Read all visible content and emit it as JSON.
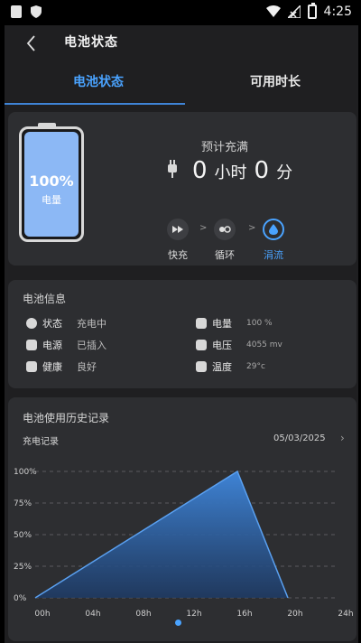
{
  "status_bar": {
    "time": "4:25"
  },
  "header": {
    "title": "电池状态",
    "back_icon": "back-chevron-icon"
  },
  "tabs": [
    {
      "label": "电池状态",
      "active": true
    },
    {
      "label": "可用时长",
      "active": false
    }
  ],
  "battery": {
    "percent_text": "100%",
    "label": "电量",
    "level": 1.0,
    "fill_color": "#8cb8f5"
  },
  "full_charge": {
    "title": "预计充满",
    "hours": "0",
    "hours_unit": "小时",
    "minutes": "0",
    "minutes_unit": "分"
  },
  "charge_modes": [
    {
      "label": "快充",
      "icon": "fast-forward-icon",
      "active": false
    },
    {
      "label": "循环",
      "icon": "cycle-icon",
      "active": false
    },
    {
      "label": "涓流",
      "icon": "trickle-drop-icon",
      "active": true
    }
  ],
  "mode_separator": ">",
  "battery_info": {
    "title": "电池信息",
    "items": [
      {
        "label": "状态",
        "value": "充电中",
        "icon": "power-icon"
      },
      {
        "label": "电源",
        "value": "已插入",
        "icon": "plug-icon"
      },
      {
        "label": "健康",
        "value": "良好",
        "icon": "health-icon"
      },
      {
        "label": "电量",
        "value": "100 %",
        "icon": "battery-level-icon"
      },
      {
        "label": "电压",
        "value": "4055 mv",
        "icon": "voltage-icon"
      },
      {
        "label": "温度",
        "value": "29°c",
        "icon": "temperature-icon"
      }
    ]
  },
  "history": {
    "title": "电池使用历史记录",
    "subtitle": "充电记录",
    "date": "05/03/2025",
    "next_icon": "chevron-right-icon"
  },
  "chart_data": {
    "type": "area",
    "x": [
      "00h",
      "04h",
      "08h",
      "12h",
      "16h",
      "20h",
      "24h"
    ],
    "x_numeric": [
      0,
      16,
      20
    ],
    "y_values": [
      0,
      100,
      0
    ],
    "y_ticks": [
      "0%",
      "25%",
      "50%",
      "75%",
      "100%"
    ],
    "ylim": [
      0,
      100
    ],
    "grid": true,
    "area_color": "#3f84d6"
  },
  "pagination": {
    "active_index": 0,
    "count": 1
  },
  "colors": {
    "accent": "#4aa3ff",
    "card_bg": "#2d2e31",
    "app_bg": "#1f1f21"
  }
}
